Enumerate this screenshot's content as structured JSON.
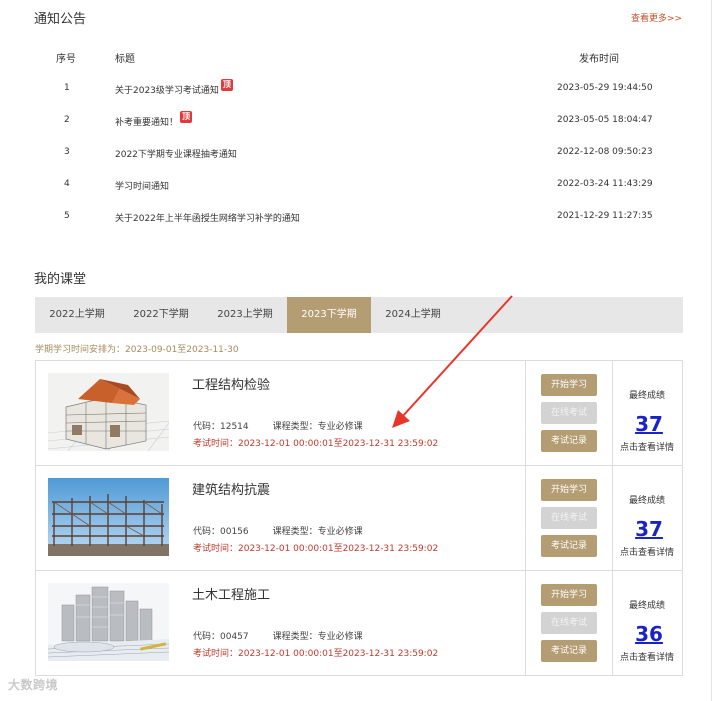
{
  "notice": {
    "title": "通知公告",
    "more": "查看更多>>",
    "headers": {
      "no": "序号",
      "title": "标题",
      "time": "发布时间"
    },
    "badge": "顶",
    "rows": [
      {
        "no": "1",
        "title": "关于2023级学习考试通知",
        "pinned": true,
        "time": "2023-05-29 19:44:50"
      },
      {
        "no": "2",
        "title": "补考重要通知！",
        "pinned": true,
        "time": "2023-05-05 18:04:47"
      },
      {
        "no": "3",
        "title": "2022下学期专业课程抽考通知",
        "pinned": false,
        "time": "2022-12-08 09:50:23"
      },
      {
        "no": "4",
        "title": "学习时间通知",
        "pinned": false,
        "time": "2022-03-24 11:43:29"
      },
      {
        "no": "5",
        "title": "关于2022年上半年函授生网络学习补学的通知",
        "pinned": false,
        "time": "2021-12-29 11:27:35"
      }
    ]
  },
  "classroom": {
    "title": "我的课堂",
    "tabs": [
      "2022上学期",
      "2022下学期",
      "2023上学期",
      "2023下学期",
      "2024上学期"
    ],
    "active_tab": 3,
    "period": "学期学习时间安排为：2023-09-01至2023-11-30",
    "buttons": {
      "start": "开始学习",
      "online": "在线考试",
      "record": "考试记录"
    },
    "score_label": "最终成绩",
    "score_hint": "点击查看详情",
    "courses": [
      {
        "name": "工程结构检验",
        "code": "代码：12514",
        "type": "课程类型：专业必修课",
        "exam": "考试时间：2023-12-01 00:00:01至2023-12-31 23:59:02",
        "score": "37",
        "image": "house-model"
      },
      {
        "name": "建筑结构抗震",
        "code": "代码：00156",
        "type": "课程类型：专业必修课",
        "exam": "考试时间：2023-12-01 00:00:01至2023-12-31 23:59:02",
        "score": "37",
        "image": "steel-frame"
      },
      {
        "name": "土木工程施工",
        "code": "代码：00457",
        "type": "课程类型：专业必修课",
        "exam": "考试时间：2023-12-01 00:00:01至2023-12-31 23:59:02",
        "score": "36",
        "image": "blueprint-buildings"
      }
    ]
  },
  "watermark": "大数跨境",
  "colors": {
    "accent": "#b49c73",
    "link": "#c0522c",
    "exam": "#c0392b",
    "score": "#1a22c9",
    "annotation_arrow": "#e8352b"
  }
}
